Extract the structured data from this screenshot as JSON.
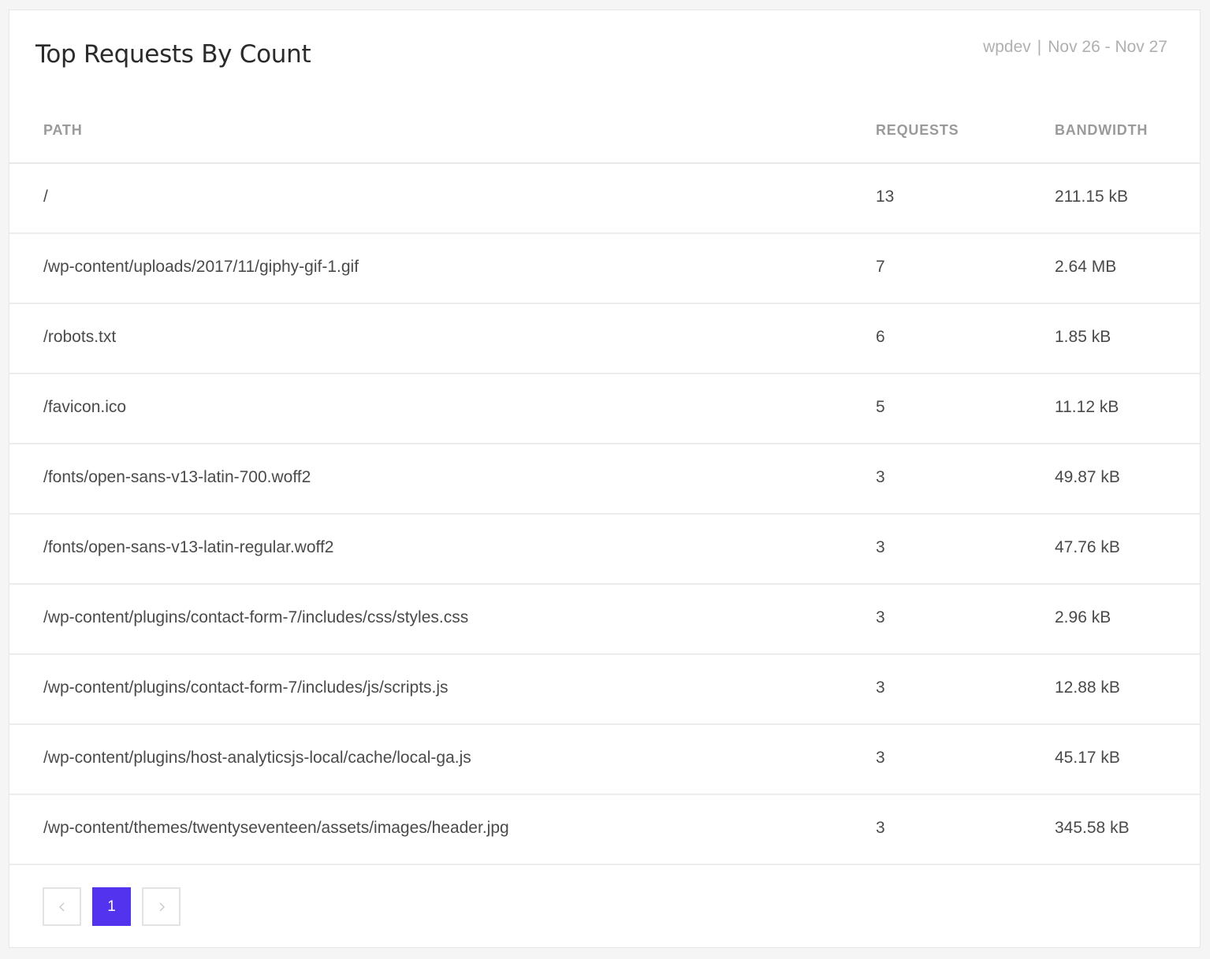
{
  "card": {
    "title": "Top Requests By Count",
    "site": "wpdev",
    "separator": "|",
    "date_range": "Nov 26 - Nov 27"
  },
  "table": {
    "headers": {
      "path": "PATH",
      "requests": "REQUESTS",
      "bandwidth": "BANDWIDTH"
    },
    "rows": [
      {
        "path": "/",
        "requests": "13",
        "bandwidth": "211.15 kB"
      },
      {
        "path": "/wp-content/uploads/2017/11/giphy-gif-1.gif",
        "requests": "7",
        "bandwidth": "2.64 MB"
      },
      {
        "path": "/robots.txt",
        "requests": "6",
        "bandwidth": "1.85 kB"
      },
      {
        "path": "/favicon.ico",
        "requests": "5",
        "bandwidth": "11.12 kB"
      },
      {
        "path": "/fonts/open-sans-v13-latin-700.woff2",
        "requests": "3",
        "bandwidth": "49.87 kB"
      },
      {
        "path": "/fonts/open-sans-v13-latin-regular.woff2",
        "requests": "3",
        "bandwidth": "47.76 kB"
      },
      {
        "path": "/wp-content/plugins/contact-form-7/includes/css/styles.css",
        "requests": "3",
        "bandwidth": "2.96 kB"
      },
      {
        "path": "/wp-content/plugins/contact-form-7/includes/js/scripts.js",
        "requests": "3",
        "bandwidth": "12.88 kB"
      },
      {
        "path": "/wp-content/plugins/host-analyticsjs-local/cache/local-ga.js",
        "requests": "3",
        "bandwidth": "45.17 kB"
      },
      {
        "path": "/wp-content/themes/twentyseventeen/assets/images/header.jpg",
        "requests": "3",
        "bandwidth": "345.58 kB"
      }
    ]
  },
  "pagination": {
    "prev_icon": "chevron-left-icon",
    "current_page": "1",
    "next_icon": "chevron-right-icon",
    "accent_color": "#5333ed"
  }
}
